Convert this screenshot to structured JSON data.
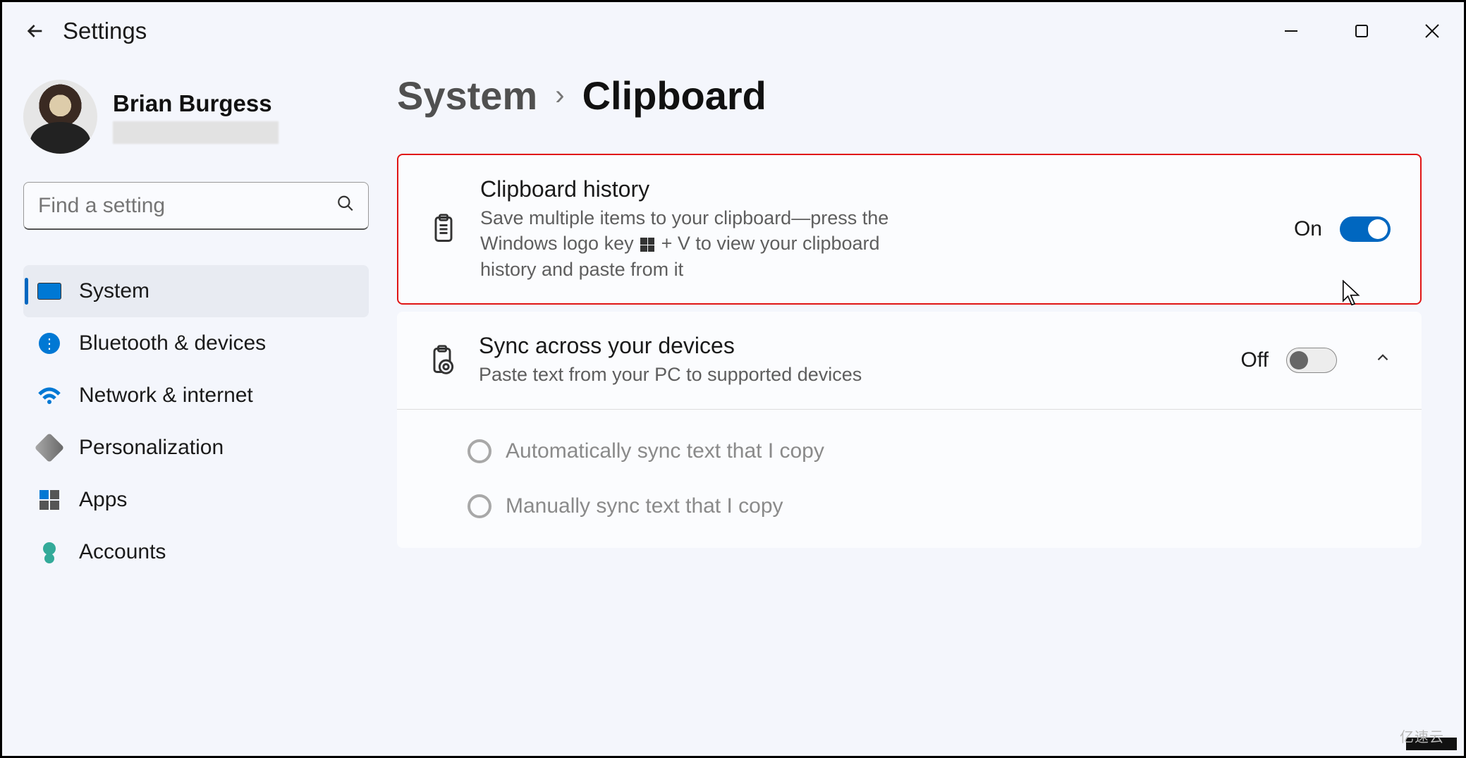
{
  "header": {
    "app_title": "Settings"
  },
  "user": {
    "name": "Brian Burgess"
  },
  "search": {
    "placeholder": "Find a setting"
  },
  "sidebar": {
    "items": [
      {
        "label": "System"
      },
      {
        "label": "Bluetooth & devices"
      },
      {
        "label": "Network & internet"
      },
      {
        "label": "Personalization"
      },
      {
        "label": "Apps"
      },
      {
        "label": "Accounts"
      }
    ]
  },
  "breadcrumb": {
    "parent": "System",
    "current": "Clipboard"
  },
  "cards": {
    "history": {
      "title": "Clipboard history",
      "desc_before": "Save multiple items to your clipboard—press the Windows logo key ",
      "desc_after": " + V to view your clipboard history and paste from it",
      "state": "On"
    },
    "sync": {
      "title": "Sync across your devices",
      "desc": "Paste text from your PC to supported devices",
      "state": "Off",
      "option_auto": "Automatically sync text that I copy",
      "option_manual": "Manually sync text that I copy"
    }
  },
  "watermark": "亿速云"
}
